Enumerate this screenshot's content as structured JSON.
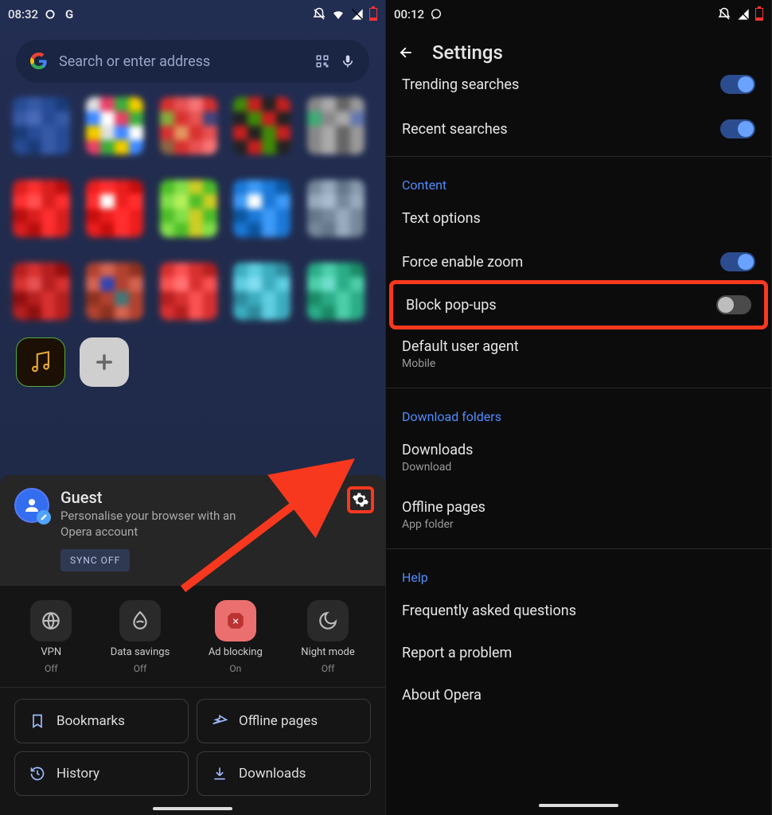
{
  "left": {
    "statusbar": {
      "time": "08:32"
    },
    "search": {
      "placeholder": "Search or enter address"
    },
    "account": {
      "title": "Guest",
      "subtitle": "Personalise your browser with an Opera account",
      "sync_button": "SYNC OFF"
    },
    "quick": [
      {
        "name": "vpn",
        "label": "VPN",
        "state": "Off"
      },
      {
        "name": "data-savings",
        "label": "Data savings",
        "state": "Off"
      },
      {
        "name": "ad-blocking",
        "label": "Ad blocking",
        "state": "On"
      },
      {
        "name": "night-mode",
        "label": "Night mode",
        "state": "Off"
      }
    ],
    "buttons": {
      "bookmarks": "Bookmarks",
      "offline": "Offline pages",
      "history": "History",
      "downloads": "Downloads"
    }
  },
  "right": {
    "statusbar": {
      "time": "00:12"
    },
    "title": "Settings",
    "rows": {
      "trending": "Trending searches",
      "recent": "Recent searches",
      "sect_content": "Content",
      "text_options": "Text options",
      "force_zoom": "Force enable zoom",
      "block_popups": "Block pop-ups",
      "default_ua": "Default user agent",
      "default_ua_sub": "Mobile",
      "sect_download": "Download folders",
      "downloads": "Downloads",
      "downloads_sub": "Download",
      "offline_pages": "Offline pages",
      "offline_pages_sub": "App folder",
      "sect_help": "Help",
      "faq": "Frequently asked questions",
      "report": "Report a problem",
      "about": "About Opera"
    }
  }
}
